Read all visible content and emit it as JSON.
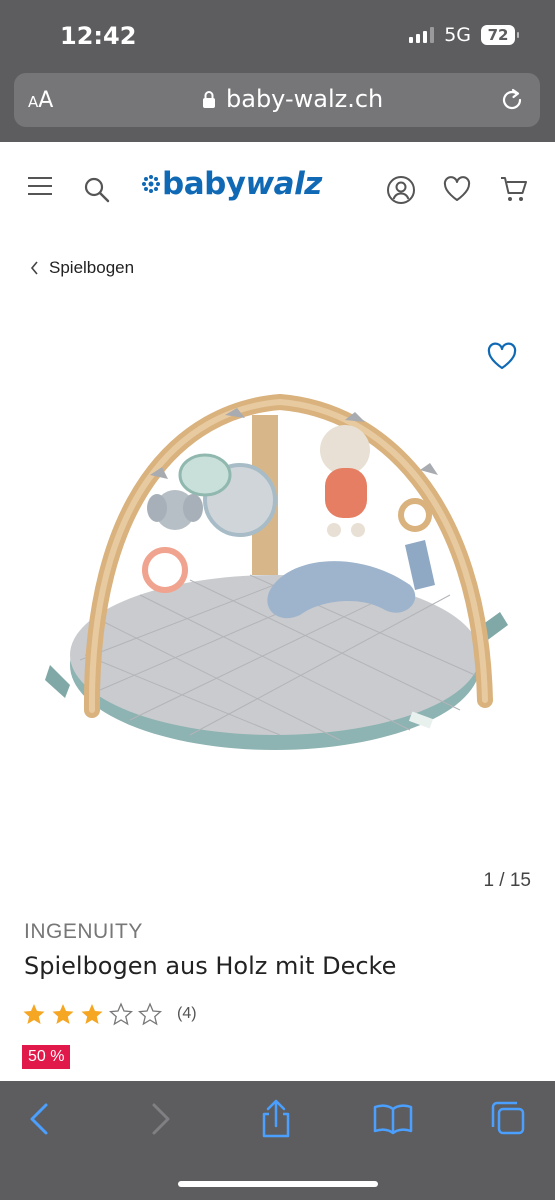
{
  "status": {
    "time": "12:42",
    "network": "5G",
    "battery": "72"
  },
  "browser": {
    "text_size_label_small": "A",
    "text_size_label_large": "A",
    "url": "baby-walz.ch"
  },
  "header": {
    "logo_part1": "baby",
    "logo_part2": "walz"
  },
  "breadcrumb": {
    "label": "Spielbogen"
  },
  "gallery": {
    "counter": "1 / 15"
  },
  "product": {
    "brand": "INGENUITY",
    "title": "Spielbogen aus Holz mit Decke",
    "rating": 3,
    "rating_max": 5,
    "review_count": "(4)",
    "discount_badge": "50 %"
  },
  "colors": {
    "brand_blue": "#0f69b4",
    "star_filled": "#f5a623",
    "badge_red": "#e1194b",
    "ios_blue": "#4a9fff",
    "chrome_gray": "#5d5d5f"
  },
  "icons": [
    "hamburger-icon",
    "search-icon",
    "account-icon",
    "heart-icon",
    "cart-icon",
    "back-icon",
    "forward-icon",
    "share-icon",
    "bookmarks-icon",
    "tabs-icon",
    "lock-icon",
    "reload-icon",
    "chevron-left-icon"
  ]
}
